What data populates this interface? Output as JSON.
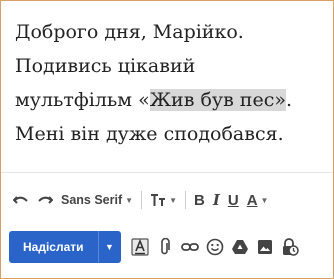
{
  "message": {
    "line1": "Доброго дня, Марійко.",
    "line2": "Подивись цікавий",
    "line3_before": "мультфільм «",
    "line3_highlight": "Жив був пес»",
    "line3_after": ".",
    "line4": "Мені він дуже сподобався."
  },
  "toolbar": {
    "font_family": "Sans Serif",
    "bold_label": "B",
    "italic_label": "I",
    "underline_label": "U",
    "text_color_label": "A",
    "icons": [
      "undo-icon",
      "redo-icon",
      "text-size-icon",
      "chevron-down-icon"
    ]
  },
  "compose": {
    "send_label": "Надіслати",
    "icons": [
      "formatting-icon",
      "attach-icon",
      "link-icon",
      "emoji-icon",
      "drive-icon",
      "photo-icon",
      "lock-clock-icon"
    ]
  },
  "colors": {
    "accent": "#2a64c9",
    "border": "#d9a066",
    "highlight": "#d8d8d8"
  }
}
